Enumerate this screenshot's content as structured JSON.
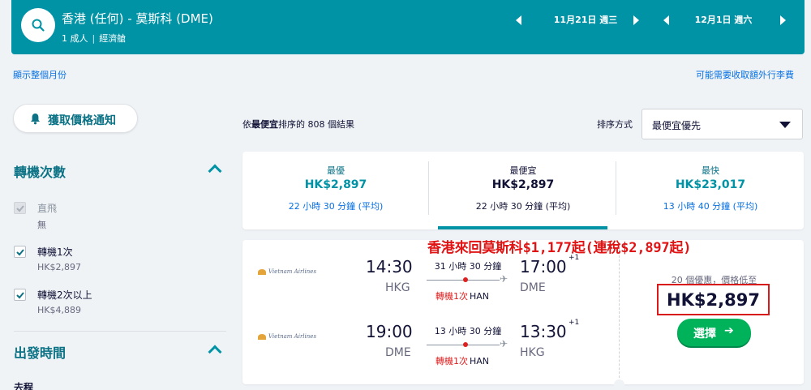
{
  "header": {
    "route": "香港 (任何) - 莫斯科 (DME)",
    "pax": "1 成人",
    "cabin": "經濟艙",
    "depart_date": "11月21日 週三",
    "return_date": "12月1日 週六"
  },
  "links": {
    "show_month": "顯示整個月份",
    "extra_baggage": "可能需要收取額外行李費"
  },
  "sidebar": {
    "alert_label": "獲取價格通知",
    "stops_title": "轉機次數",
    "options": [
      {
        "label": "直飛",
        "price": "無",
        "checked": true,
        "disabled": true
      },
      {
        "label": "轉機1次",
        "price": "HK$2,897",
        "checked": true,
        "disabled": false
      },
      {
        "label": "轉機2次以上",
        "price": "HK$4,889",
        "checked": true,
        "disabled": false
      }
    ],
    "depart_title": "出發時間",
    "next_label": "去程"
  },
  "results": {
    "summary_pre": "依",
    "summary_bold": "最便宜",
    "summary_post": "排序的 808 個結果",
    "sort_label": "排序方式",
    "sort_value": "最便宜優先"
  },
  "tabs": [
    {
      "title": "最優",
      "price": "HK$2,897",
      "duration": "22 小時 30 分鐘 (平均)"
    },
    {
      "title": "最便宜",
      "price": "HK$2,897",
      "duration": "22 小時 30 分鐘 (平均)"
    },
    {
      "title": "最快",
      "price": "HK$23,017",
      "duration": "13 小時 40 分鐘 (平均)"
    }
  ],
  "promo": "香港來回莫斯科$1,177起(連稅$2,897起)",
  "itinerary": {
    "airline": "Vietnam Airlines",
    "outbound": {
      "dep_time": "14:30",
      "dep_code": "HKG",
      "duration": "31 小時 30 分鐘",
      "stops": "轉機1次",
      "via": "HAN",
      "arr_time": "17:00",
      "arr_code": "DME",
      "day_offset": "+1"
    },
    "inbound": {
      "dep_time": "19:00",
      "dep_code": "DME",
      "duration": "13 小時 30 分鐘",
      "stops": "轉機1次",
      "via": "HAN",
      "arr_time": "13:30",
      "arr_code": "HKG",
      "day_offset": "+1"
    },
    "deals_text": "20 個優惠，價格低至",
    "price": "HK$2,897",
    "select_label": "選擇",
    "select_arrow": "➔"
  },
  "colors": {
    "brand": "#0092a5",
    "cta": "#00b25a",
    "highlight": "#d91a1a"
  }
}
